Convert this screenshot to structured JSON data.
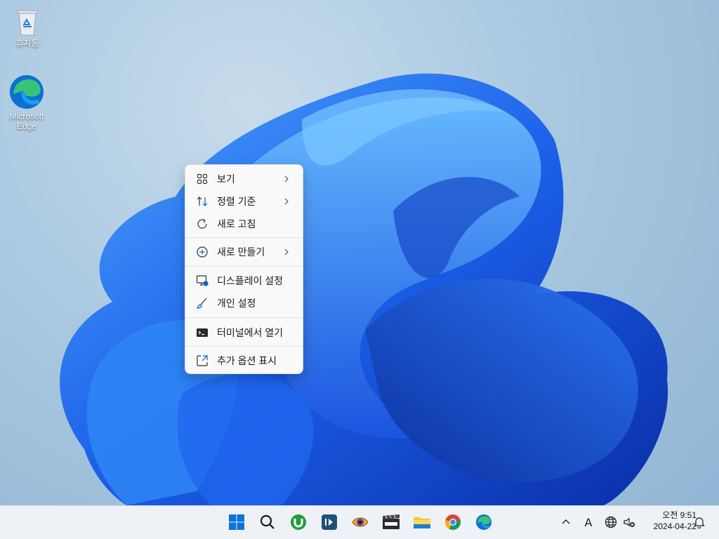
{
  "desktop": {
    "icons": [
      {
        "label": "휴지통",
        "icon": "recycle-bin-icon"
      },
      {
        "label": "Microsoft Edge",
        "icon": "edge-icon"
      }
    ]
  },
  "context_menu": {
    "items": [
      {
        "label": "보기",
        "icon": "view-grid-icon",
        "submenu": true
      },
      {
        "label": "정렬 기준",
        "icon": "sort-icon",
        "submenu": true
      },
      {
        "label": "새로 고침",
        "icon": "refresh-icon",
        "submenu": false
      },
      {
        "label": "새로 만들기",
        "icon": "new-plus-icon",
        "submenu": true
      },
      {
        "label": "디스플레이 설정",
        "icon": "display-settings-icon",
        "submenu": false
      },
      {
        "label": "개인 설정",
        "icon": "personalize-brush-icon",
        "submenu": false
      },
      {
        "label": "터미널에서 열기",
        "icon": "terminal-icon",
        "submenu": false
      },
      {
        "label": "추가 옵션 표시",
        "icon": "more-options-icon",
        "submenu": false
      }
    ]
  },
  "taskbar": {
    "apps": [
      "start-icon",
      "search-icon",
      "utorrent-icon",
      "app-1d-icon",
      "eye-app-icon",
      "hpc-be-icon",
      "file-explorer-icon",
      "chrome-icon",
      "edge-icon"
    ],
    "tray": [
      "chevron-up-icon",
      "ime-a-icon",
      "network-icon",
      "volume-muted-icon"
    ],
    "ime_label": "A",
    "clock": {
      "time": "오전 9:51",
      "date": "2024-04-22"
    },
    "notification_icon": "bell-icon"
  },
  "colors": {
    "accent": "#0067c0",
    "menu_bg": "#f9f9f9",
    "taskbar_bg": "#eef1f6",
    "bloom": "#1a5ce6"
  }
}
